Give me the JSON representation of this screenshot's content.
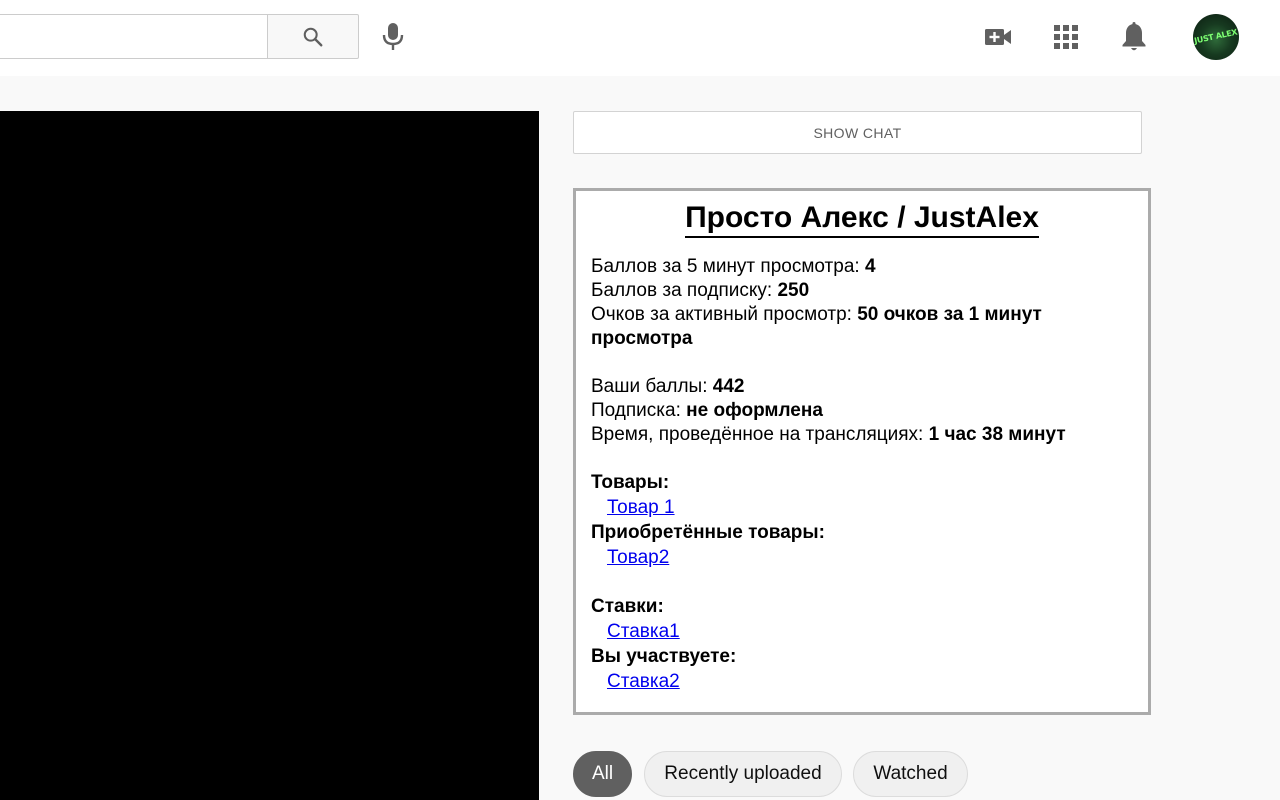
{
  "header": {
    "search": {
      "value": "",
      "placeholder": ""
    },
    "icons": [
      "search-icon",
      "mic-icon",
      "create-video-icon",
      "apps-grid-icon",
      "notifications-bell-icon",
      "avatar"
    ],
    "avatar_text": "JUST ALEX"
  },
  "chat": {
    "show_label": "SHOW CHAT"
  },
  "panel": {
    "title": "Просто Алекс / JustAlex",
    "points_watch_label": "Баллов за 5 минут просмотра: ",
    "points_watch_value": "4",
    "points_sub_label": "Баллов за подписку: ",
    "points_sub_value": "250",
    "active_watch_label": "Очков за активный просмотр: ",
    "active_watch_value": "50 очков за 1 минут просмотра",
    "your_points_label": "Ваши баллы: ",
    "your_points_value": "442",
    "subscription_label": "Подписка: ",
    "subscription_value": "не оформлена",
    "time_label": "Время, проведённое на трансляциях: ",
    "time_value": "1 час 38 минут",
    "goods_heading": "Товары:",
    "goods": [
      "Товар 1"
    ],
    "purchased_heading": "Приобретённые товары:",
    "purchased": [
      "Товар2"
    ],
    "bets_heading": "Ставки:",
    "bets": [
      "Ставка1"
    ],
    "participating_heading": "Вы участвуете:",
    "participating": [
      "Ставка2"
    ]
  },
  "chips": [
    {
      "label": "All",
      "active": true
    },
    {
      "label": "Recently uploaded",
      "active": false
    },
    {
      "label": "Watched",
      "active": false
    }
  ],
  "colors": {
    "chip_active_bg": "#606060",
    "link": "#0000ee",
    "panel_border": "#ababab"
  }
}
